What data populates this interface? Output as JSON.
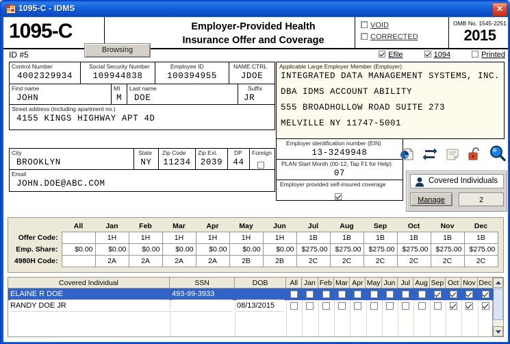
{
  "window": {
    "title": "1095-C - IDMS",
    "close_label": "✕"
  },
  "masthead": {
    "form_number": "1095-C",
    "status_button": "Browsing",
    "title_line1": "Employer-Provided Health",
    "title_line2": "Insurance Offer and Coverage",
    "void_label": "VOID",
    "void_checked": false,
    "corrected_label": "CORRECTED",
    "corrected_checked": false,
    "omb_label": "OMB No. 1545-2251",
    "year": "2015"
  },
  "id_row": {
    "id_label": "ID #5",
    "efile_label": "Efile",
    "efile_checked": true,
    "f1094_label": "1094",
    "f1094_checked": true,
    "printed_label": "Printed",
    "printed_checked": false
  },
  "employee": {
    "control_number_label": "Control Number",
    "control_number": "4002329934",
    "ssn_label": "Social Security Number",
    "ssn": "109944838",
    "employee_id_label": "Employee ID",
    "employee_id": "100394955",
    "name_ctrl_label": "NAME CTRL",
    "name_ctrl": "JDOE",
    "first_name_label": "First name",
    "first_name": "JOHN",
    "mi_label": "MI",
    "mi": "M",
    "last_name_label": "Last name",
    "last_name": "DOE",
    "suffix_label": "Suffix",
    "suffix": "JR",
    "street_label": "Street address (including apartment no.)",
    "street": "4155 KINGS HIGHWAY APT 4D",
    "city_label": "City",
    "city": "BROOKLYN",
    "state_label": "State",
    "state": "NY",
    "zip_label": "Zip Code",
    "zip": "11234",
    "zip_ext_label": "Zip Ext.",
    "zip_ext": "2039",
    "dp_label": "DP",
    "dp": "44",
    "foreign_label": "Foreign",
    "foreign_checked": false,
    "email_label": "Email",
    "email": "JOHN.DOE@ABC.COM"
  },
  "employer": {
    "label": "Applicable Large Employer Member (Employer)",
    "lines": [
      "INTEGRATED DATA MANAGEMENT SYSTEMS, INC.",
      "DBA IDMS ACCOUNT ABILITY",
      "555 BROADHOLLOW ROAD SUITE 273",
      "MELVILLE NY 11747-5001"
    ],
    "ein_label": "Employer identification number (EIN)",
    "ein": "13-3249948",
    "plan_month_label": "PLAN Start Month (00-12, Tap F1 for Help)",
    "plan_month": "07",
    "self_insured_label": "Employer provided self-insured coverage",
    "self_insured_checked": true
  },
  "toolbar": {
    "icons": [
      "report-chart-icon",
      "exchange-arrows-icon",
      "notes-icon",
      "unlock-icon",
      "search-magnifier-icon"
    ]
  },
  "covered_panel": {
    "header_label": "Covered Individuals",
    "manage_label": "Manage",
    "count": "2"
  },
  "chart_data": {
    "type": "table",
    "title": "Monthly Offer and Coverage",
    "columns": [
      "All",
      "Jan",
      "Feb",
      "Mar",
      "Apr",
      "May",
      "Jun",
      "Jul",
      "Aug",
      "Sep",
      "Oct",
      "Nov",
      "Dec"
    ],
    "rows": [
      {
        "label": "Offer Code:",
        "values": [
          "",
          "1H",
          "1H",
          "1H",
          "1H",
          "1H",
          "1H",
          "1B",
          "1B",
          "1B",
          "1B",
          "1B",
          "1B"
        ]
      },
      {
        "label": "Emp. Share:",
        "values": [
          "$0.00",
          "$0.00",
          "$0.00",
          "$0.00",
          "$0.00",
          "$0.00",
          "$0.00",
          "$275.00",
          "$275.00",
          "$275.00",
          "$275.00",
          "$275.00",
          "$275.00"
        ]
      },
      {
        "label": "4980H Code:",
        "values": [
          "",
          "2A",
          "2A",
          "2A",
          "2A",
          "2B",
          "2B",
          "2C",
          "2C",
          "2C",
          "2C",
          "2C",
          "2C"
        ]
      }
    ]
  },
  "covered_grid": {
    "headers": [
      "Covered Individual",
      "SSN",
      "DOB",
      "All",
      "Jan",
      "Feb",
      "Mar",
      "Apr",
      "May",
      "Jun",
      "Jul",
      "Aug",
      "Sep",
      "Oct",
      "Nov",
      "Dec"
    ],
    "rows": [
      {
        "name": "ELAINE R DOE",
        "ssn": "493-99-3933",
        "dob": "",
        "selected": true,
        "months": [
          false,
          false,
          false,
          false,
          false,
          false,
          false,
          false,
          false,
          true,
          true,
          true,
          true
        ]
      },
      {
        "name": "RANDY DOE JR",
        "ssn": "",
        "dob": "08/13/2015",
        "selected": false,
        "months": [
          false,
          false,
          false,
          false,
          false,
          false,
          false,
          false,
          false,
          false,
          true,
          true,
          true
        ]
      }
    ]
  }
}
